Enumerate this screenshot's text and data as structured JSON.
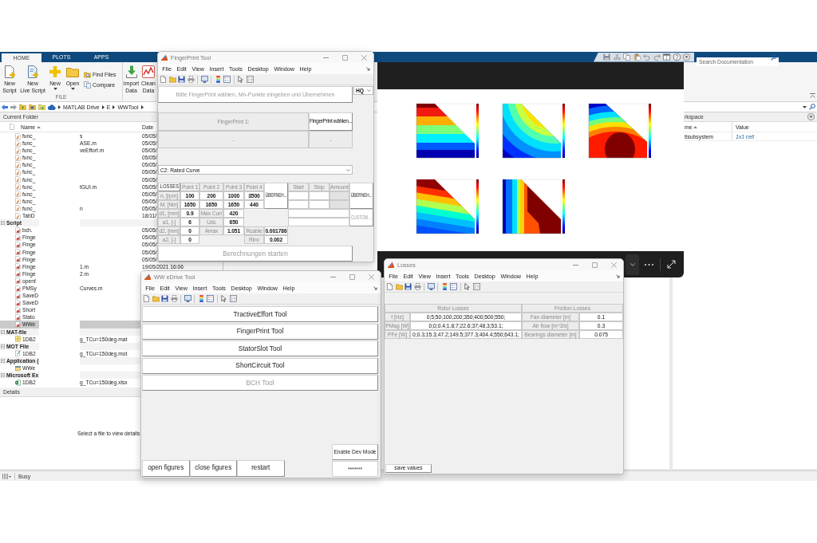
{
  "matlab": {
    "tabs": [
      {
        "label": "HOME",
        "selected": true
      },
      {
        "label": "PLOTS",
        "selected": false
      },
      {
        "label": "APPS",
        "selected": false
      }
    ],
    "search": {
      "placeholder": "Search Documentation"
    },
    "toolstrip": {
      "sections": [
        {
          "label": "FILE",
          "buttons": [
            {
              "kind": "large",
              "lines": [
                "New",
                "Script"
              ]
            },
            {
              "kind": "large",
              "lines": [
                "New",
                "Live Script"
              ]
            },
            {
              "kind": "menu",
              "lines": [
                "New"
              ]
            },
            {
              "kind": "menu",
              "lines": [
                "Open"
              ]
            },
            {
              "kind": "small",
              "lines": [
                "Find Files"
              ]
            },
            {
              "kind": "small",
              "lines": [
                "Compare"
              ]
            }
          ]
        },
        {
          "buttons": [
            {
              "kind": "large",
              "lines": [
                "Import",
                "Data"
              ]
            },
            {
              "kind": "large",
              "lines": [
                "Clean",
                "Data"
              ]
            }
          ]
        }
      ]
    },
    "address": {
      "path": [
        "MATLAB Drive",
        "E",
        "WWTool"
      ]
    },
    "current_folder": {
      "title": "Current Folder",
      "columns": [
        {
          "label": "Name",
          "sorted": true
        },
        {
          "label": "Date",
          "sorted": false
        }
      ],
      "groups": [
        {
          "items": [
            {
              "kind": "function",
              "name": "func_",
              "suffix": "s",
              "date": "05/05/",
              "selected": false
            },
            {
              "kind": "function",
              "name": "func_",
              "suffix": "ASE.m",
              "date": "05/05/",
              "selected": false
            },
            {
              "kind": "function",
              "name": "func_",
              "suffix": "veEffort.m",
              "date": "05/05/",
              "selected": false
            },
            {
              "kind": "function",
              "name": "func_",
              "date": "05/05/",
              "selected": false
            },
            {
              "kind": "function",
              "name": "func_",
              "date": "05/05/",
              "selected": false
            },
            {
              "kind": "function",
              "name": "func_",
              "date": "05/05/",
              "selected": false
            },
            {
              "kind": "function",
              "name": "func_",
              "date": "05/05/",
              "selected": false
            },
            {
              "kind": "function",
              "name": "func_",
              "suffix": "tGUI.m",
              "date": "05/05/",
              "selected": false
            },
            {
              "kind": "function",
              "name": "func_",
              "date": "05/05/",
              "selected": false
            },
            {
              "kind": "function",
              "name": "func_",
              "date": "05/05/",
              "selected": false
            },
            {
              "kind": "function",
              "name": "func_",
              "suffix": "n",
              "date": "05/05/",
              "selected": false
            },
            {
              "kind": "function",
              "name": "TabD",
              "date": "18/11/",
              "selected": false
            }
          ]
        },
        {
          "label": "Script",
          "expanded": true,
          "items": [
            {
              "kind": "script",
              "name": "bch.",
              "date": "05/05/",
              "selected": false
            },
            {
              "kind": "script",
              "name": "Finge",
              "date": "05/05/",
              "selected": false
            },
            {
              "kind": "script",
              "name": "Finge",
              "date": "05/05/",
              "selected": false
            },
            {
              "kind": "script",
              "name": "Finge",
              "date": "05/05/",
              "selected": false
            },
            {
              "kind": "script",
              "name": "Finge",
              "date": "05/05/",
              "selected": false
            },
            {
              "kind": "script",
              "name": "Finge",
              "suffix": "1.m",
              "date": "19/05/2021 16:06",
              "selected": false
            },
            {
              "kind": "script",
              "name": "Finge",
              "suffix": "2.m",
              "selected": false
            },
            {
              "kind": "script",
              "name": "openf",
              "selected": false
            },
            {
              "kind": "script",
              "name": "PMSy",
              "suffix": "Curves.m",
              "selected": false
            },
            {
              "kind": "script",
              "name": "SaveD",
              "selected": false
            },
            {
              "kind": "script",
              "name": "SaveD",
              "selected": false
            },
            {
              "kind": "script",
              "name": "Short",
              "selected": false
            },
            {
              "kind": "script",
              "name": "Stato",
              "selected": false
            },
            {
              "kind": "script",
              "name": "WWe",
              "selected": true
            }
          ]
        },
        {
          "label": "MAT-file",
          "expanded": true,
          "items": [
            {
              "kind": "mat",
              "name": "1DB2",
              "suffix": "g_TCu=150deg.mat",
              "selected": false
            }
          ]
        },
        {
          "label": "MOT File",
          "expanded": true,
          "items": [
            {
              "kind": "mot",
              "name": "1DB2",
              "suffix": "g_TCu=150deg.mot",
              "selected": false
            }
          ]
        },
        {
          "label": "Application (",
          "expanded": true,
          "items": [
            {
              "kind": "app",
              "name": "WWe",
              "selected": false
            }
          ]
        },
        {
          "label": "Microsoft Ex",
          "expanded": true,
          "items": [
            {
              "kind": "excel",
              "name": "1DB2",
              "suffix": "g_TCu=150deg.xlsx",
              "selected": false
            }
          ]
        }
      ],
      "details_title": "Details",
      "details_hint": "Select a file to view details"
    },
    "workspace": {
      "title": "rkspace",
      "columns": [
        {
          "label": "me",
          "sorted": true
        },
        {
          "label": "Value",
          "sorted": false
        }
      ],
      "rows": [
        {
          "name": "tlsubsystem",
          "value": "1x1 cell"
        }
      ]
    },
    "status": "Busy"
  },
  "fingerprint_tool": {
    "title": "FingerPrint Tool",
    "menu": [
      "File",
      "Edit",
      "View",
      "Insert",
      "Tools",
      "Desktop",
      "Window",
      "Help"
    ],
    "instruction_button": {
      "label": "Bitte FingerPrint wählen, Mn-Punkte eingeben und Übernehmen",
      "disabled": true
    },
    "quality_select": {
      "value": "HQ"
    },
    "fingerprint": {
      "label": "FingerPrint 1:",
      "button": "FingerPrint wählen...",
      "name": "-",
      "file": "-"
    },
    "curve_select": {
      "value": "C2: Rated Curve"
    },
    "losses_button": "LOSSES",
    "point_columns": [
      "Point 1",
      "Point 2",
      "Point 3",
      "Point 4"
    ],
    "point_rows": [
      {
        "label": "n, [rpm]",
        "values": [
          "100",
          "200",
          "1000",
          "3500"
        ]
      },
      {
        "label": "M, [Nm]",
        "values": [
          "1650",
          "1650",
          "1650",
          "440"
        ]
      }
    ],
    "apply_points_button": "ÜBERNEH...",
    "geometry": [
      {
        "label": "d1, [mm]",
        "value": "0.9"
      },
      {
        "label": "a1, [-]",
        "value": "6"
      },
      {
        "label": "d2, [mm]",
        "value": "0"
      },
      {
        "label": "a2, [-]",
        "value": "0"
      }
    ],
    "machine": [
      {
        "label": "Max Curr",
        "value": "420"
      },
      {
        "label": "Udc",
        "value": "650"
      },
      {
        "label": "Amax",
        "value": "1.051"
      }
    ],
    "resistances": [
      {
        "label": "Rcable",
        "value": "0.001786"
      },
      {
        "label": "Rinv",
        "value": "0.002"
      }
    ],
    "range_columns": [
      "Start",
      "Stop",
      "Amount"
    ],
    "range_rows": [
      {
        "fields": [
          {
            "disabled": false
          },
          {
            "disabled": false
          },
          {
            "disabled": true
          }
        ]
      },
      {
        "fields": [
          {
            "disabled": false
          },
          {
            "disabled": false
          },
          {
            "disabled": true
          }
        ]
      }
    ],
    "custom_fields": [
      {
        "disabled": false
      },
      {
        "disabled": false
      }
    ],
    "apply_range_button": "ÜBERNEH...",
    "custom_button": {
      "label": "CUSTOM ...",
      "disabled": true
    },
    "start_button": {
      "label": "Berechnungen starten",
      "disabled": true
    }
  },
  "edrive_tool": {
    "title": "WW eDrive Tool",
    "menu": [
      "File",
      "Edit",
      "View",
      "Insert",
      "Tools",
      "Desktop",
      "Window",
      "Help"
    ],
    "tool_buttons": [
      {
        "label": "TractiveEffort Tool",
        "disabled": false
      },
      {
        "label": "FingerPrint Tool",
        "disabled": false
      },
      {
        "label": "StatorSlot Tool",
        "disabled": false
      },
      {
        "label": "ShortCircuit Tool",
        "disabled": false
      },
      {
        "label": "BCH Tool",
        "disabled": true
      }
    ],
    "bottom_buttons": [
      "open figures",
      "close figures",
      "restart"
    ],
    "dev_button": "Enable Dev Mode",
    "password": {
      "value": "*******"
    }
  },
  "losses": {
    "title": "Losses",
    "menu": [
      "File",
      "Edit",
      "View",
      "Insert",
      "Tools",
      "Desktop",
      "Window",
      "Help"
    ],
    "rotor": {
      "title": "Rotor Losses",
      "rows": [
        {
          "label": "f [Hz]",
          "value": "0;5;50;100;200;350;400;500;550;"
        },
        {
          "label": "PMag [W]",
          "value": "0;0;0.4;1.8;7;22.6;37;48.3;53.1;"
        },
        {
          "label": "PFe [W]",
          "value": "0;0.3;15.3;47.2;149.5;377.3;404.4;550;643.1;"
        }
      ]
    },
    "friction": {
      "title": "Friction Losses",
      "rows": [
        {
          "label": "Fan diameter [m]",
          "value": "0.1"
        },
        {
          "label": "Air flow [m^3/s]",
          "value": "0.3"
        },
        {
          "label": "Bearings diameter [m]",
          "value": "0.075"
        }
      ]
    },
    "save_button": "save values"
  }
}
